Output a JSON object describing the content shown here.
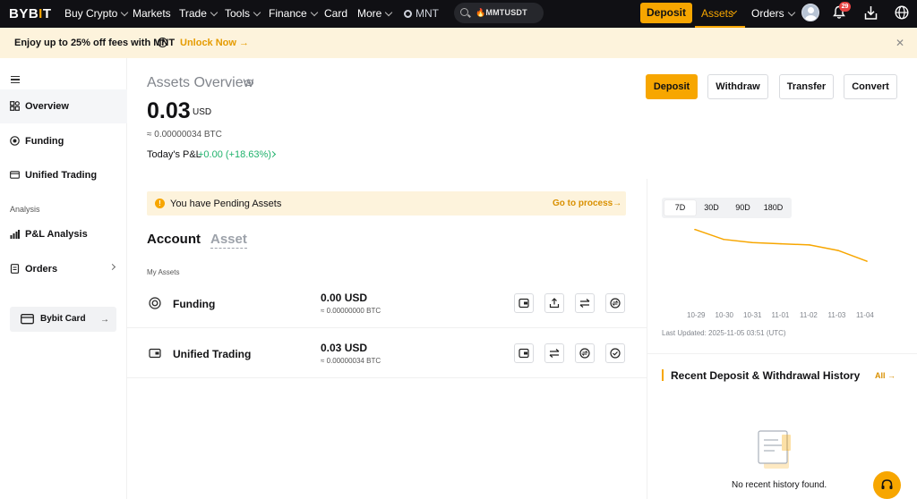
{
  "topnav": {
    "logo": "BYBIT",
    "items": [
      "Buy Crypto",
      "Markets",
      "Trade",
      "Tools",
      "Finance",
      "Card",
      "More"
    ],
    "mnt_label": "MNT",
    "search_value": "MMTUSDT",
    "deposit_label": "Deposit",
    "assets_label": "Assets",
    "orders_label": "Orders",
    "notification_count": "29"
  },
  "promo": {
    "text": "Enjoy up to 25% off fees with MNT",
    "cta": "Unlock Now"
  },
  "sidebar": {
    "items": [
      {
        "label": "Overview",
        "icon": "overview-icon"
      },
      {
        "label": "Funding",
        "icon": "funding-icon"
      },
      {
        "label": "Unified Trading",
        "icon": "unified-trading-icon"
      }
    ],
    "section_label": "Analysis",
    "analysis_items": [
      {
        "label": "P&L Analysis",
        "icon": "chart-icon"
      },
      {
        "label": "Orders",
        "icon": "orders-icon"
      }
    ],
    "card_label": "Bybit Card"
  },
  "overview": {
    "title": "Assets Overview",
    "balance": "0.03",
    "balance_unit": "USD",
    "btc_approx": "≈ 0.00000034 BTC",
    "pnl_label": "Today's P&L",
    "pnl_value": "+0.00 (+18.63%)"
  },
  "actions": [
    "Deposit",
    "Withdraw",
    "Transfer",
    "Convert"
  ],
  "pending": {
    "text": "You have Pending Assets",
    "cta": "Go to process"
  },
  "tabs": [
    "Account",
    "Asset"
  ],
  "my_assets_label": "My Assets",
  "assets": [
    {
      "name": "Funding",
      "value": "0.00 USD",
      "btc": "≈ 0.00000000 BTC"
    },
    {
      "name": "Unified Trading",
      "value": "0.03 USD",
      "btc": "≈ 0.00000034 BTC"
    }
  ],
  "chart": {
    "ranges": [
      "7D",
      "30D",
      "90D",
      "180D"
    ],
    "selected_range": "7D",
    "last_updated": "Last Updated: 2025-11-05 03:51 (UTC)"
  },
  "chart_data": {
    "type": "line",
    "x": [
      "10-29",
      "10-30",
      "10-31",
      "11-01",
      "11-02",
      "11-03",
      "11-04"
    ],
    "values": [
      0.0385,
      0.036,
      0.0352,
      0.0349,
      0.0346,
      0.0332,
      0.0305
    ],
    "series_color": "#f7a600"
  },
  "history": {
    "title": "Recent Deposit & Withdrawal History",
    "all_label": "All",
    "empty_text": "No recent history found."
  },
  "colors": {
    "accent": "#f7a600",
    "positive": "#20b26c",
    "nav_bg": "#101014",
    "banner_bg": "#fdf3dc"
  }
}
